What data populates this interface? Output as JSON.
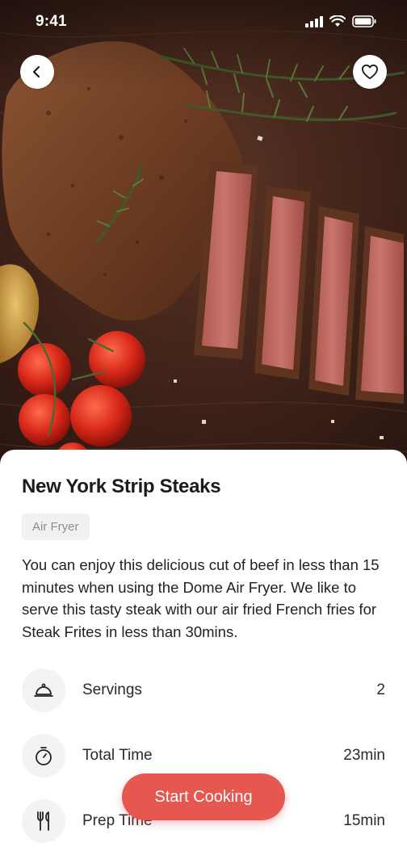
{
  "status_bar": {
    "time": "9:41"
  },
  "hero": {
    "image": "steak-photo"
  },
  "nav": {
    "back_icon": "chevron-left-icon",
    "favorite_icon": "heart-icon"
  },
  "recipe": {
    "title": "New York Strip Steaks",
    "tag": "Air Fryer",
    "description": "You can enjoy this delicious cut of beef in less than 15 minutes when using the Dome Air Fryer. We like to serve this tasty steak with our air fried French fries for Steak Frites in less than 30mins.",
    "details": [
      {
        "icon": "cloche-icon",
        "label": "Servings",
        "value": "2"
      },
      {
        "icon": "timer-icon",
        "label": "Total Time",
        "value": "23min"
      },
      {
        "icon": "utensils-icon",
        "label": "Prep Time",
        "value": "15min"
      }
    ]
  },
  "cta": {
    "label": "Start Cooking"
  },
  "colors": {
    "accent": "#e5574f",
    "tag_bg": "#f1f1f1",
    "icon_bg": "#f3f3f3"
  }
}
